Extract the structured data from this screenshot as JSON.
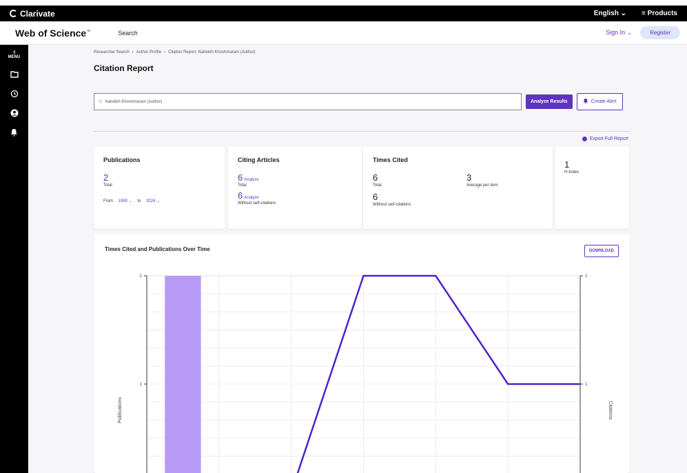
{
  "brand": {
    "name": "Clarivate",
    "language": "English",
    "products": "Products"
  },
  "appbar": {
    "title": "Web of Science",
    "search": "Search",
    "signin": "Sign In",
    "register": "Register"
  },
  "sidebar": {
    "menu": "MENU"
  },
  "breadcrumb": [
    "Researcher Search",
    "Author Profile",
    "Citation Report: Nahideh Khoshmaram (Author)"
  ],
  "page_title": "Citation Report",
  "search": {
    "value": "Nahideh Khoshmaram (Author)",
    "analyze": "Analyze Results",
    "alert": "Create Alert"
  },
  "export": "Export Full Report",
  "cards": {
    "publications": {
      "title": "Publications",
      "value": "2",
      "label": "Total",
      "from_label": "From",
      "from": "1990",
      "to_label": "to",
      "to": "2024"
    },
    "citing": {
      "title": "Citing Articles",
      "value1": "6",
      "analyze1": "Analyze",
      "label1": "Total",
      "value2": "6",
      "analyze2": "Analyze",
      "label2": "Without self-citations"
    },
    "times_cited": {
      "title": "Times Cited",
      "value1": "6",
      "label1": "Total",
      "avg": "3",
      "avg_label": "Average per item",
      "value2": "6",
      "label2": "Without self-citations"
    },
    "hindex": {
      "value": "1",
      "label": "H-Index"
    }
  },
  "chart_title": "Times Cited and Publications Over Time",
  "download": "DOWNLOAD",
  "chart_data": {
    "type": "bar",
    "y_left_label": "Publications",
    "y_right_label": "Citations",
    "y_ticks": [
      "2",
      "1"
    ],
    "ylim_visible": [
      0.2,
      2
    ],
    "bars": [
      {
        "index": 0,
        "value": 2,
        "color": "#b89bf7"
      }
    ],
    "line": {
      "color": "#4f1fc9",
      "values": [
        null,
        null,
        0,
        2,
        2,
        1,
        1
      ]
    },
    "note": "x-axis category labels not visible in screenshot"
  }
}
